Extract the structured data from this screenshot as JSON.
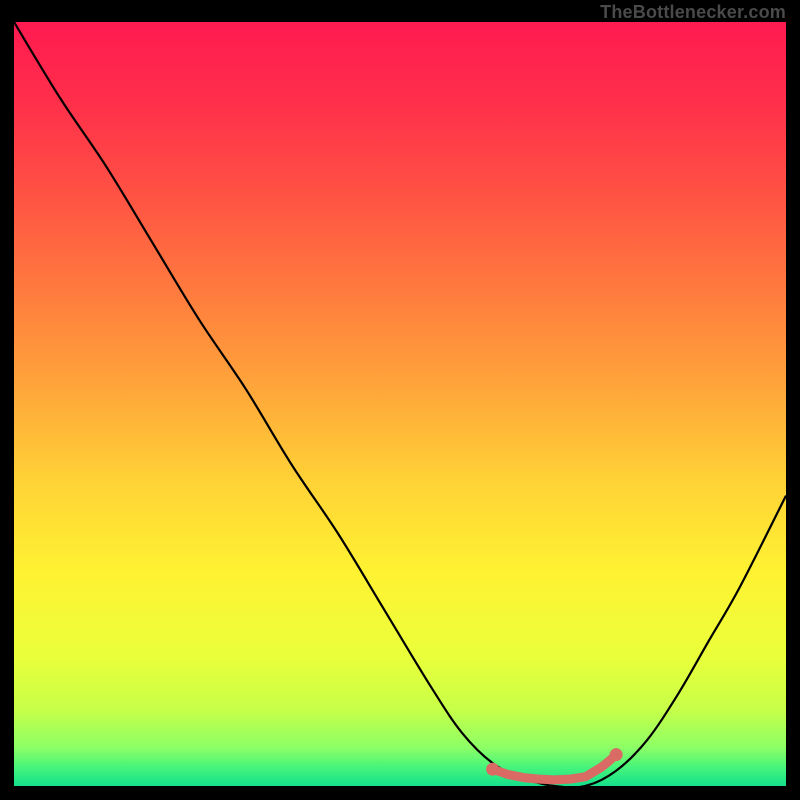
{
  "attribution": "TheBottlenecker.com",
  "colors": {
    "frame": "#000000",
    "curve": "#000000",
    "marker": "#da6a64",
    "gradient_stops": [
      {
        "offset": 0.0,
        "color": "#ff1a50"
      },
      {
        "offset": 0.1,
        "color": "#ff2e4b"
      },
      {
        "offset": 0.22,
        "color": "#ff5044"
      },
      {
        "offset": 0.35,
        "color": "#ff7a3e"
      },
      {
        "offset": 0.48,
        "color": "#ffa63a"
      },
      {
        "offset": 0.6,
        "color": "#ffd236"
      },
      {
        "offset": 0.72,
        "color": "#fff232"
      },
      {
        "offset": 0.83,
        "color": "#eaff3a"
      },
      {
        "offset": 0.9,
        "color": "#c7ff48"
      },
      {
        "offset": 0.95,
        "color": "#8cff66"
      },
      {
        "offset": 0.975,
        "color": "#48f47a"
      },
      {
        "offset": 1.0,
        "color": "#14e08c"
      }
    ]
  },
  "chart_data": {
    "type": "line",
    "title": "",
    "xlabel": "",
    "ylabel": "",
    "xlim": [
      0,
      100
    ],
    "ylim": [
      0,
      100
    ],
    "grid": false,
    "series": [
      {
        "name": "bottleneck-curve",
        "x": [
          0,
          6,
          12,
          18,
          24,
          30,
          36,
          42,
          48,
          54,
          58,
          62,
          66,
          70,
          74,
          78,
          82,
          86,
          90,
          94,
          100
        ],
        "values": [
          100,
          90,
          81,
          71,
          61,
          52,
          42,
          33,
          23,
          13,
          7,
          3,
          1,
          0,
          0,
          2,
          6,
          12,
          19,
          26,
          38
        ]
      }
    ],
    "annotations": [
      {
        "name": "optimal-range-markers",
        "x": [
          62,
          64,
          66,
          68,
          70,
          72,
          74,
          75,
          76,
          77,
          78
        ],
        "values": [
          2.2,
          1.5,
          1.1,
          0.9,
          0.8,
          0.9,
          1.2,
          1.8,
          2.4,
          3.2,
          4.1
        ]
      }
    ]
  }
}
